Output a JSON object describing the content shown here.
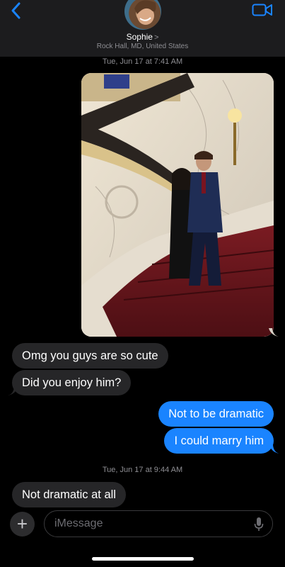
{
  "header": {
    "contact_name": "Sophie",
    "chevron": ">",
    "location": "Rock Hall, MD, United States"
  },
  "timestamps": [
    "Tue, Jun 17 at 7:41 AM",
    "Tue, Jun 17 at 9:44 AM"
  ],
  "messages": [
    {
      "direction": "incoming",
      "text": "Omg you guys are so cute"
    },
    {
      "direction": "incoming",
      "text": "Did you enjoy him?"
    },
    {
      "direction": "outgoing",
      "text": "Not to be dramatic"
    },
    {
      "direction": "outgoing",
      "text": "I could marry him"
    },
    {
      "direction": "incoming",
      "text": "Not dramatic at all"
    }
  ],
  "input": {
    "placeholder": "iMessage",
    "plus_label": "+"
  },
  "colors": {
    "accent": "#1a84ff",
    "incoming_bubble": "#262628",
    "header_bg": "#1c1c1e"
  },
  "icons": [
    "chevron-left-icon",
    "video-camera-icon",
    "plus-icon",
    "microphone-icon"
  ]
}
